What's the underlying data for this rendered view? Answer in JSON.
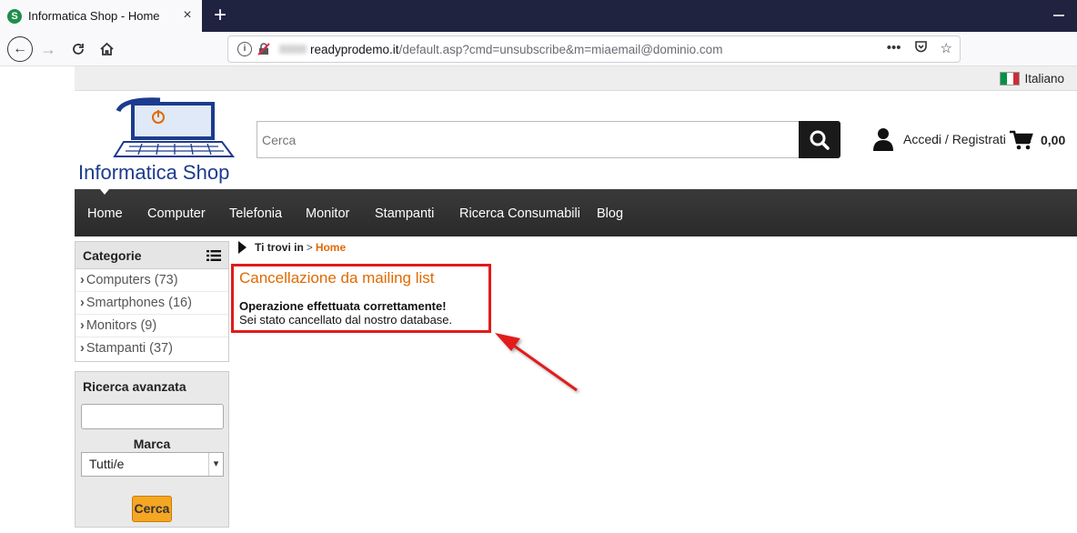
{
  "browser": {
    "tab_title": "Informatica Shop - Home",
    "tab_favicon_letter": "S",
    "url_host": "readyprodemo.it",
    "url_path": "/default.asp?cmd=unsubscribe&m=miaemail@dominio.com"
  },
  "site": {
    "language": "Italiano",
    "logo_text": "Informatica Shop",
    "search_placeholder": "Cerca",
    "account_label": "Accedi / Registrati",
    "cart_total": "0,00",
    "menu": [
      "Home",
      "Computer",
      "Telefonia",
      "Monitor",
      "Stampanti",
      "Ricerca Consumabili",
      "Blog"
    ]
  },
  "sidebar": {
    "categories_title": "Categorie",
    "categories": [
      "Computers (73)",
      "Smartphones (16)",
      "Monitors (9)",
      "Stampanti (37)"
    ],
    "advanced_title": "Ricerca avanzata",
    "brand_label": "Marca",
    "brand_selected": "Tutti/e",
    "search_button": "Cerca"
  },
  "breadcrumb": {
    "prefix": "Ti trovi in",
    "separator": ">",
    "current": "Home"
  },
  "message": {
    "title": "Cancellazione da mailing list",
    "status": "Operazione effettuata correttamente!",
    "text": "Sei stato cancellato dal nostro database."
  },
  "colors": {
    "accent_orange": "#e06a00",
    "highlight_red": "#e11b1b",
    "menu_bg": "#2a2a2a"
  }
}
